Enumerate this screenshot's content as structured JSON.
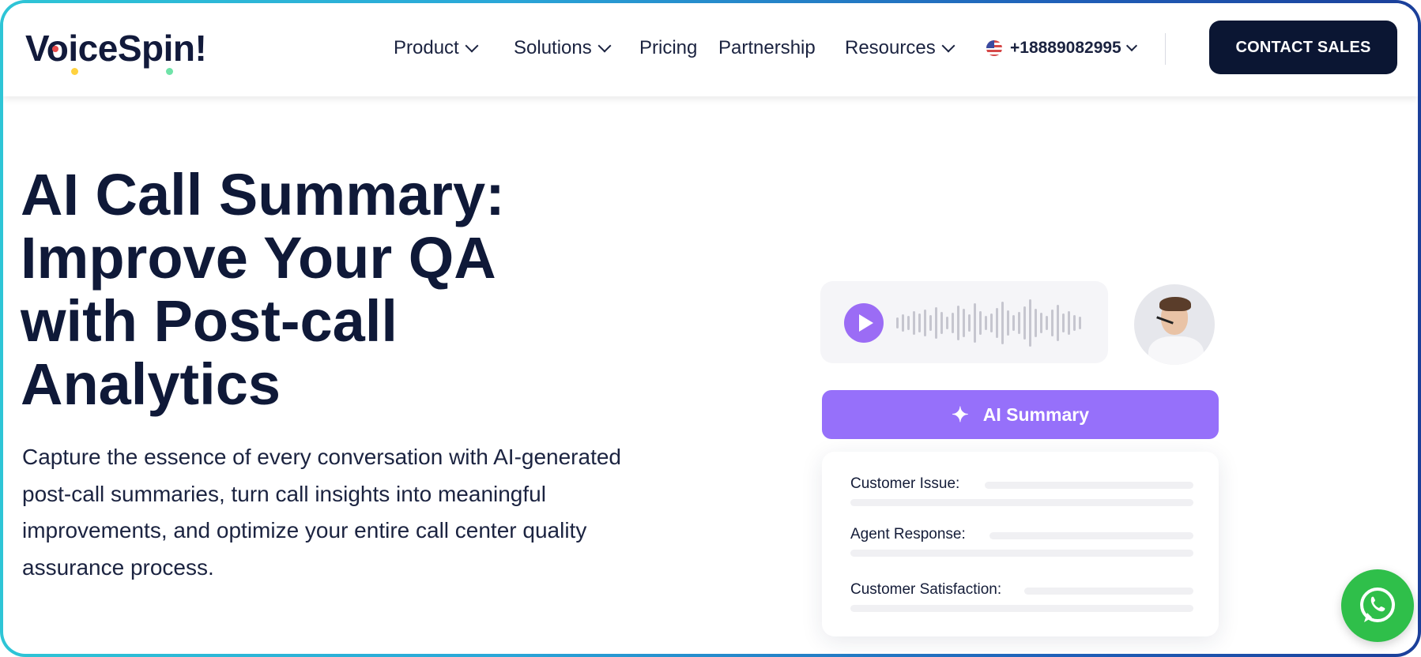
{
  "brand": {
    "logo_text": "VoiceSpin!"
  },
  "nav": {
    "items": [
      {
        "label": "Product",
        "has_dropdown": true
      },
      {
        "label": "Solutions",
        "has_dropdown": true
      },
      {
        "label": "Pricing",
        "has_dropdown": false
      },
      {
        "label": "Partnership",
        "has_dropdown": false
      },
      {
        "label": "Resources",
        "has_dropdown": true
      }
    ],
    "phone": "+18889082995",
    "phone_flag_icon": "us-flag-icon",
    "cta_label": "CONTACT SALES"
  },
  "hero": {
    "title_lines": [
      "AI Call Summary:",
      "Improve Your QA",
      "with Post-call",
      "Analytics"
    ],
    "subtitle_lines": [
      "Capture the essence of every conversation with AI-generated",
      "post-call summaries, turn call insights into meaningful",
      "improvements, and optimize your entire call center quality",
      "assurance process."
    ]
  },
  "illustration": {
    "ai_summary_label": "AI Summary",
    "summary_fields": [
      "Customer Issue:",
      "Agent Response:",
      "Customer Satisfaction:"
    ]
  },
  "colors": {
    "accent_purple": "#9670fa",
    "navy": "#0b1633",
    "whatsapp_green": "#2fbf4a"
  }
}
